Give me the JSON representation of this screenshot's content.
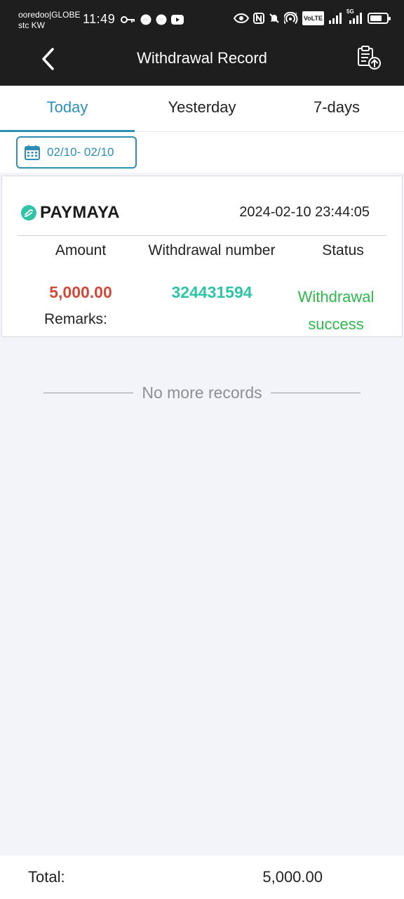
{
  "status_bar": {
    "carrier_1": "ooredoo|GLOBE",
    "carrier_2": "stc KW",
    "time": "11:49",
    "volte": "VoLTE",
    "signal_label": "5G",
    "icons_left": [
      "key-icon",
      "messenger-icon",
      "messenger-icon",
      "youtube-icon"
    ],
    "icons_right": [
      "eye-icon",
      "nfc-icon",
      "mute-icon",
      "hotspot-icon",
      "volte-icon",
      "signal-icon",
      "signal-5g-icon",
      "battery-icon"
    ]
  },
  "header": {
    "title": "Withdrawal Record",
    "back_icon": "chevron-left-icon",
    "report_icon": "clipboard-upload-icon"
  },
  "tabs": [
    {
      "label": "Today",
      "active": true
    },
    {
      "label": "Yesterday",
      "active": false
    },
    {
      "label": "7-days",
      "active": false
    }
  ],
  "filter": {
    "date_range": "02/10- 02/10",
    "icon": "calendar-icon"
  },
  "record": {
    "method": "PAYMAYA",
    "datetime": "2024-02-10 23:44:05",
    "col_amount": "Amount",
    "col_number": "Withdrawal number",
    "col_status": "Status",
    "amount": "5,000.00",
    "withdrawal_number": "324431594",
    "status": "Withdrawal success",
    "remarks_label": "Remarks:"
  },
  "list_end_text": "No more records",
  "footer": {
    "total_label": "Total:",
    "total_value": "5,000.00"
  },
  "colors": {
    "accent": "#2d8fb5",
    "amount": "#d04a3a",
    "withdrawal_number": "#2ec4a8",
    "status_success": "#2db84b",
    "header_bg": "#1e1e1e",
    "page_bg": "#f3f4fa"
  }
}
